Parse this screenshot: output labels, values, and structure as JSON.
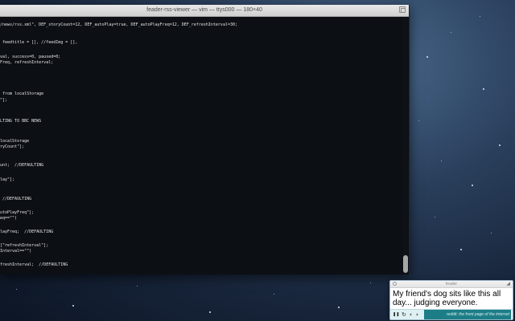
{
  "terminal": {
    "title": "feader-rss-viewer — vim — ttys000 — 180×40",
    "lines": [
      "/news/rss.xml\", DEF_storyCount=12, DEF_autoPlay=true, DEF_autoPlayFreq=12, DEF_refreshInterval=30;",
      " feedtitle = [], //feedImg = [],",
      "val, success=0, paused=0;",
      "Freq, refreshInterval;",
      " from localStorage",
      "\"];",
      "LTING TO BBC NEWS",
      "localStorage",
      "ryCount\"];",
      "unt;  //DEFAULTING",
      "lay\"];",
      " //DEFAULTING",
      "utoPlayFreq\"];",
      "eq==\"\")",
      "layFreq;  //DEFAULTING",
      "[\"refreshInterval\"];",
      "Interval==\"\")",
      "freshInterval;  //DEFAULTING"
    ]
  },
  "feeder": {
    "window_title": "feader",
    "headline": "My friend's dog sits like this all day... judging everyone.",
    "source": "reddit: the front page of the internet",
    "controls": {
      "pause": "❚❚",
      "refresh": "↻",
      "prev": "‹",
      "next": "›"
    },
    "colors": {
      "source_bar": "#1d7d86",
      "controls_bg": "#dff0f3"
    }
  }
}
